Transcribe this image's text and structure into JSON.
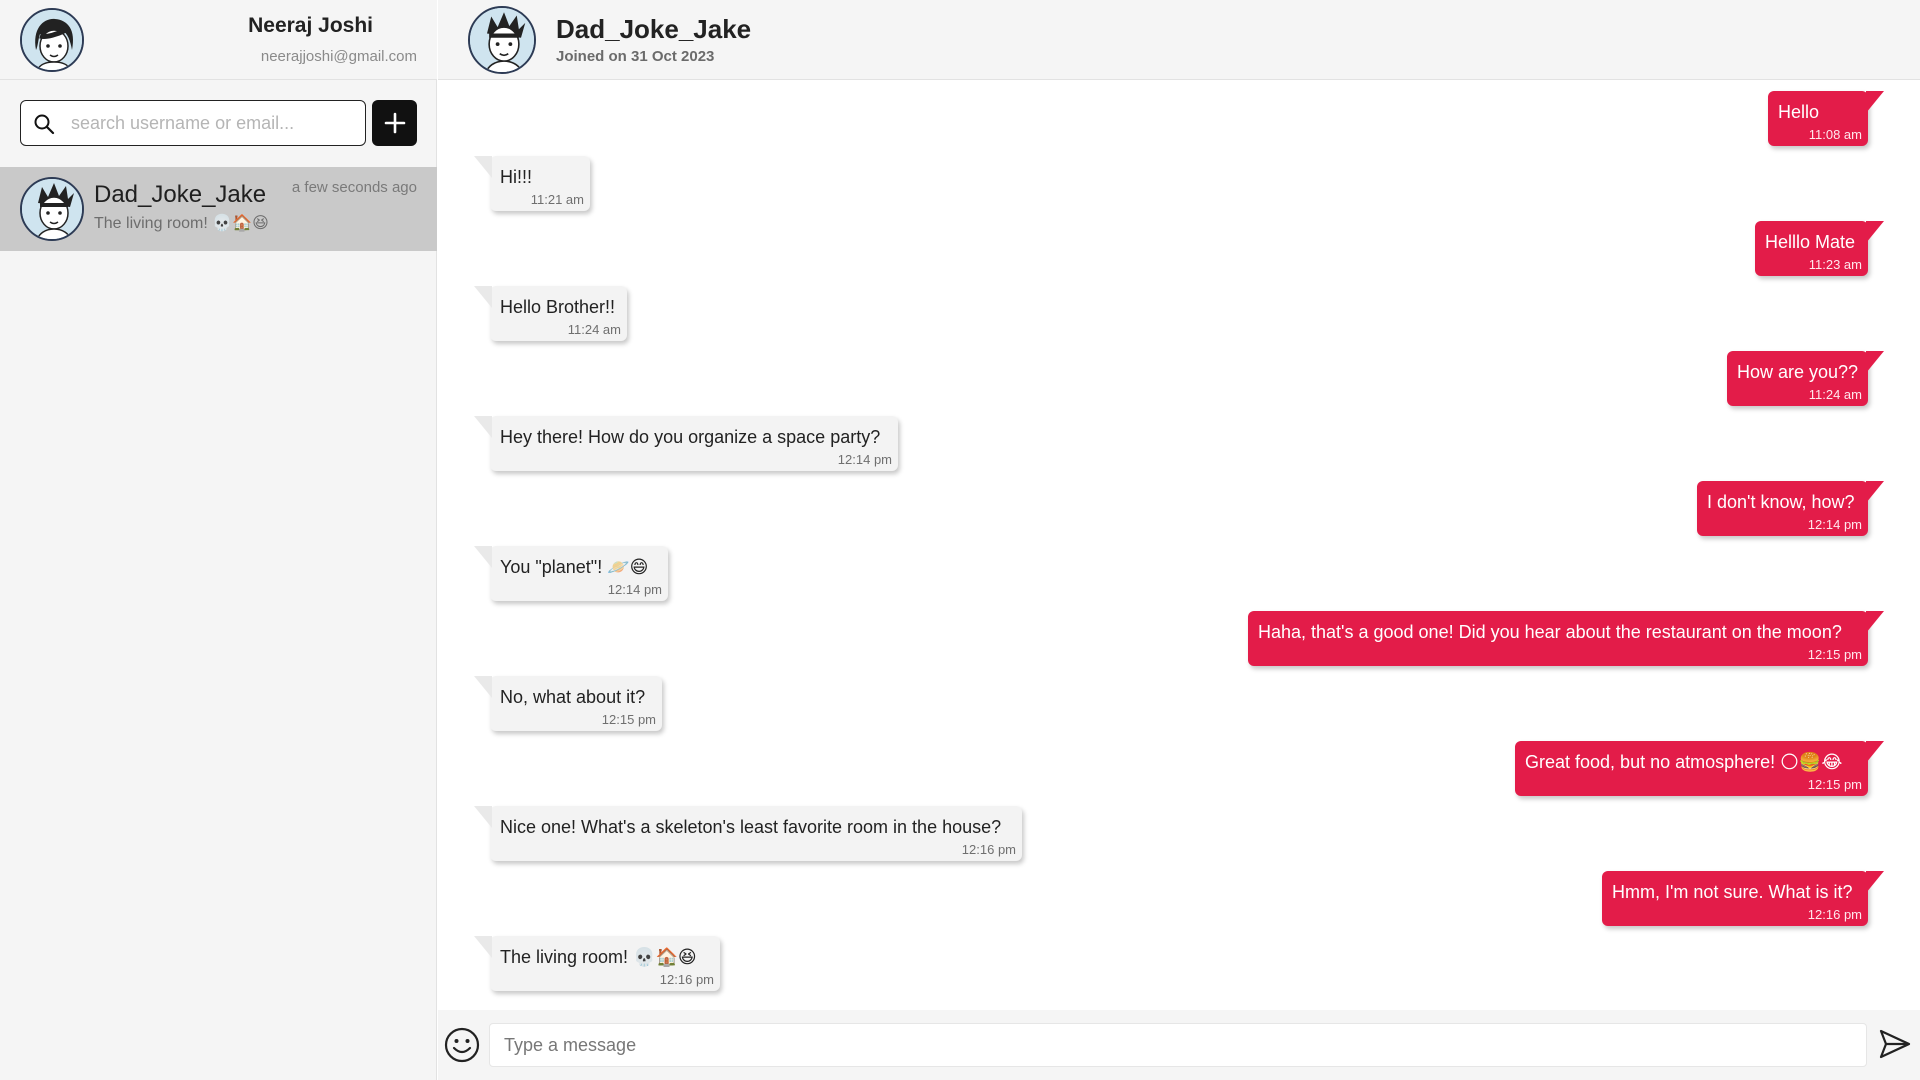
{
  "profile": {
    "name": "Neeraj Joshi",
    "email": "neerajjoshi@gmail.com"
  },
  "search": {
    "placeholder": "search username or email...",
    "value": ""
  },
  "add_button_icon": "plus-icon",
  "contacts": [
    {
      "name": "Dad_Joke_Jake",
      "preview": "The living room! 💀🏠😆",
      "time": "a few seconds ago",
      "selected": true
    }
  ],
  "chat": {
    "title": "Dad_Joke_Jake",
    "subtitle": "Joined on 31 Oct 2023"
  },
  "messages": [
    {
      "dir": "out",
      "text": "Hello",
      "time": "11:08 am"
    },
    {
      "dir": "in",
      "text": "Hi!!!",
      "time": "11:21 am"
    },
    {
      "dir": "out",
      "text": "Helllo Mate",
      "time": "11:23 am"
    },
    {
      "dir": "in",
      "text": "Hello Brother!!",
      "time": "11:24 am"
    },
    {
      "dir": "out",
      "text": "How are you??",
      "time": "11:24 am"
    },
    {
      "dir": "in",
      "text": "Hey there! How do you organize a space party?",
      "time": "12:14 pm"
    },
    {
      "dir": "out",
      "text": "I don't know, how?",
      "time": "12:14 pm"
    },
    {
      "dir": "in",
      "text": "You \"planet\"! 🪐😄",
      "time": "12:14 pm"
    },
    {
      "dir": "out",
      "text": "Haha, that's a good one! Did you hear about the restaurant on the moon?",
      "time": "12:15 pm"
    },
    {
      "dir": "in",
      "text": "No, what about it?",
      "time": "12:15 pm"
    },
    {
      "dir": "out",
      "text": "Great food, but no atmosphere! 🌕🍔😂",
      "time": "12:15 pm"
    },
    {
      "dir": "in",
      "text": "Nice one! What's a skeleton's least favorite room in the house?",
      "time": "12:16 pm"
    },
    {
      "dir": "out",
      "text": "Hmm, I'm not sure. What is it?",
      "time": "12:16 pm"
    },
    {
      "dir": "in",
      "text": "The living room! 💀🏠😆",
      "time": "12:16 pm"
    }
  ],
  "composer": {
    "placeholder": "Type a message",
    "value": ""
  },
  "colors": {
    "accent": "#e31c49",
    "incoming_bubble": "#f3f3f3",
    "selected_contact": "#c9c9c9"
  }
}
